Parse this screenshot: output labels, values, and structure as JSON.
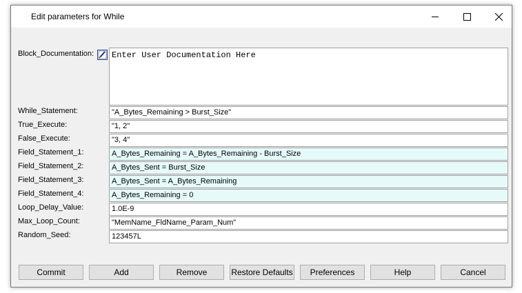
{
  "window": {
    "title": "Edit parameters for While"
  },
  "block_documentation": {
    "label": "Block_Documentation:",
    "value": "Enter User Documentation Here",
    "icon": "edit-document-icon"
  },
  "params": [
    {
      "label": "While_Statement:",
      "value": "\"A_Bytes_Remaining > Burst_Size\"",
      "highlighted": false
    },
    {
      "label": "True_Execute:",
      "value": "\"1, 2\"",
      "highlighted": false
    },
    {
      "label": "False_Execute:",
      "value": "\"3, 4\"",
      "highlighted": false
    },
    {
      "label": "Field_Statement_1:",
      "value": "A_Bytes_Remaining = A_Bytes_Remaining - Burst_Size",
      "highlighted": true
    },
    {
      "label": "Field_Statement_2:",
      "value": "A_Bytes_Sent = Burst_Size",
      "highlighted": true
    },
    {
      "label": "Field_Statement_3:",
      "value": "A_Bytes_Sent = A_Bytes_Remaining",
      "highlighted": true
    },
    {
      "label": "Field_Statement_4:",
      "value": "A_Bytes_Remaining = 0",
      "highlighted": true
    },
    {
      "label": "Loop_Delay_Value:",
      "value": "1.0E-9",
      "highlighted": false
    },
    {
      "label": "Max_Loop_Count:",
      "value": "\"MemName_FldName_Param_Num\"",
      "highlighted": false
    },
    {
      "label": "Random_Seed:",
      "value": "123457L",
      "highlighted": false
    }
  ],
  "buttons": {
    "commit": "Commit",
    "add": "Add",
    "remove": "Remove",
    "restore_defaults": "Restore Defaults",
    "preferences": "Preferences",
    "help": "Help",
    "cancel": "Cancel"
  },
  "colors": {
    "highlight_field": "#e6fafa",
    "dialog_bg": "#f0f0f0"
  }
}
